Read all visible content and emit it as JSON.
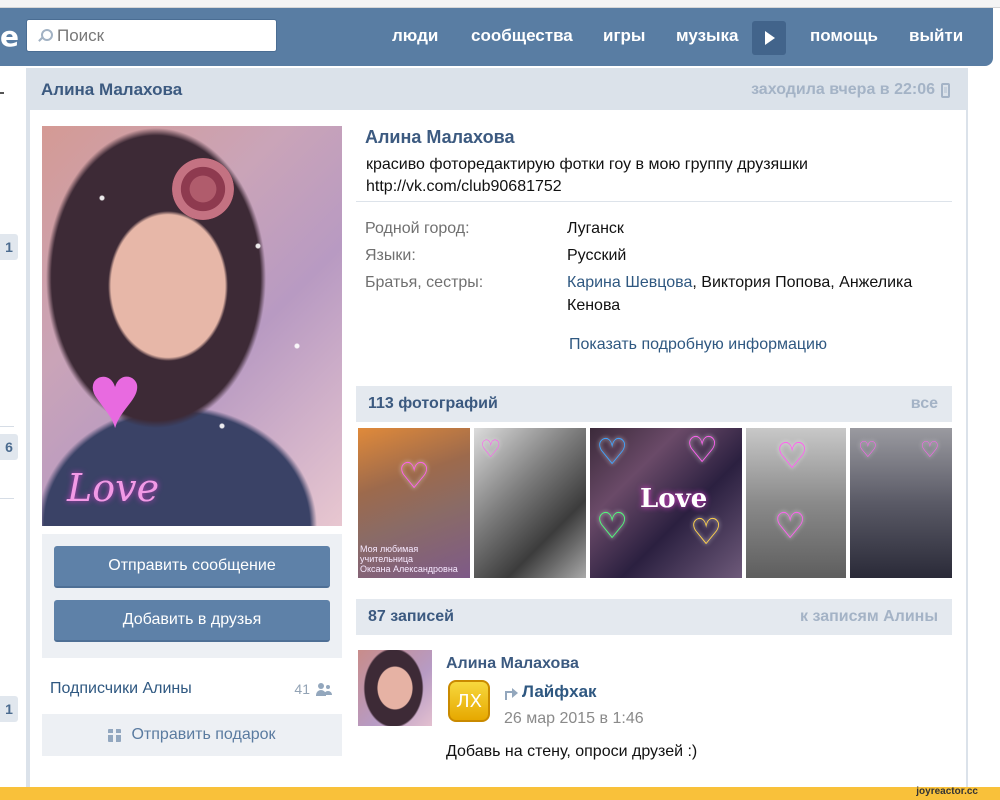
{
  "header": {
    "logo_fragment": "e",
    "search_placeholder": "Поиск",
    "nav": {
      "people": "люди",
      "communities": "сообщества",
      "games": "игры",
      "music": "музыка",
      "help": "помощь",
      "logout": "выйти"
    }
  },
  "sidebar_fragments": {
    "badges": [
      "1",
      "6",
      "1"
    ]
  },
  "profile": {
    "name": "Алина Малахова",
    "last_seen": "заходила вчера в 22:06",
    "status_line1": "красиво фоторедактирую фотки гоу в мою группу друзяшки",
    "status_line2": "http://vk.com/club90681752",
    "info": {
      "hometown_label": "Родной город:",
      "hometown_value": "Луганск",
      "languages_label": "Языки:",
      "languages_value": "Русский",
      "siblings_label": "Братья, сестры:",
      "sibling_1": "Карина Шевцова",
      "siblings_rest": ", Виктория Попова, Анжелика Кенова"
    },
    "more_info_link": "Показать подробную информацию",
    "avatar_overlay_text": "Love"
  },
  "actions": {
    "send_message": "Отправить сообщение",
    "add_friend": "Добавить в друзья",
    "followers_label": "Подписчики Алины",
    "followers_count": "41",
    "send_gift": "Отправить подарок"
  },
  "photos": {
    "title": "113 фотографий",
    "all_link": "все",
    "caption_line1": "Моя любимая учительница",
    "caption_line2": "Оксана Александровна",
    "collage_word": "Love"
  },
  "wall": {
    "title": "87 записей",
    "link": "к записям Алины",
    "post": {
      "author": "Алина Малахова",
      "badge": "ЛХ",
      "group": "Лайфхак",
      "date": "26 мар 2015 в 1:46",
      "text": "Добавь на стену, опроси друзей :)"
    }
  },
  "footer": {
    "site": "joyreactor.cc"
  }
}
